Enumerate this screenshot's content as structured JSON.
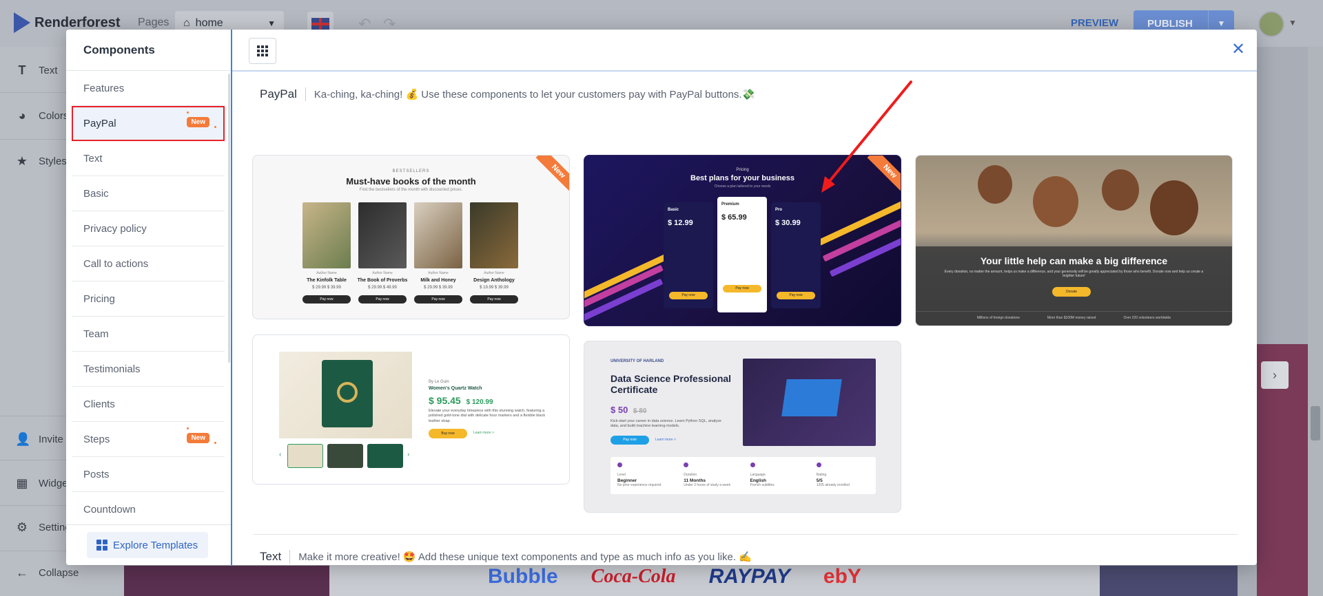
{
  "app": {
    "brand": "Renderforest",
    "pages_label": "Pages",
    "current_page": "home",
    "preview_label": "PREVIEW",
    "publish_label": "PUBLISH"
  },
  "sidebar": {
    "items": [
      {
        "label": "Text",
        "icon": "text-icon"
      },
      {
        "label": "Colors",
        "icon": "palette-icon"
      },
      {
        "label": "Styles",
        "icon": "star-icon"
      },
      {
        "label": "Invite",
        "icon": "add-user-icon"
      },
      {
        "label": "Widgets",
        "icon": "widgets-icon"
      },
      {
        "label": "Settings",
        "icon": "gear-icon"
      },
      {
        "label": "Collapse",
        "icon": "arrow-left-icon"
      }
    ]
  },
  "canvas": {
    "brands": [
      "Bubble",
      "Coca-Cola",
      "RAYPAY",
      "ebY"
    ]
  },
  "modal": {
    "title": "Components",
    "categories": [
      {
        "label": "Features",
        "badge": ""
      },
      {
        "label": "PayPal",
        "badge": "New"
      },
      {
        "label": "Text",
        "badge": ""
      },
      {
        "label": "Basic",
        "badge": ""
      },
      {
        "label": "Privacy policy",
        "badge": ""
      },
      {
        "label": "Call to actions",
        "badge": ""
      },
      {
        "label": "Pricing",
        "badge": ""
      },
      {
        "label": "Team",
        "badge": ""
      },
      {
        "label": "Testimonials",
        "badge": ""
      },
      {
        "label": "Clients",
        "badge": ""
      },
      {
        "label": "Steps",
        "badge": "New"
      },
      {
        "label": "Posts",
        "badge": ""
      },
      {
        "label": "Countdown",
        "badge": ""
      }
    ],
    "explore_label": "Explore Templates",
    "sections": [
      {
        "name": "PayPal",
        "description": "Ka-ching, ka-ching! 💰 Use these components to let your customers pay with PayPal buttons.💸"
      },
      {
        "name": "Text",
        "description": "Make it more creative! 🤩 Add these unique text components and type as much info as you like. ✍️"
      }
    ],
    "ribbon_label": "New",
    "cards": {
      "books": {
        "pre": "BESTSELLERS",
        "title": "Must-have books of the month",
        "subtitle": "Find the bestsellers of the month with discounted prices.",
        "items": [
          {
            "meta": "Author Name",
            "title": "The Kinfolk Table",
            "price": "$ 29.99  $ 39.99",
            "btn": "Pay now"
          },
          {
            "meta": "Author Name",
            "title": "The Book of Proverbs",
            "price": "$ 29.99  $ 49.99",
            "btn": "Pay now"
          },
          {
            "meta": "Author Name",
            "title": "Milk and Honey",
            "price": "$ 29.99  $ 39.99",
            "btn": "Pay now"
          },
          {
            "meta": "Author Name",
            "title": "Design Anthology",
            "price": "$ 19.99  $ 39.99",
            "btn": "Pay now"
          }
        ]
      },
      "pricing": {
        "pre": "Pricing",
        "title": "Best plans for your business",
        "subtitle": "Choose a plan tailored to your needs",
        "plans": [
          {
            "name": "Basic",
            "price": "$ 12.99",
            "btn": "Pay now"
          },
          {
            "name": "Premium",
            "price": "$ 65.99",
            "btn": "Pay now"
          },
          {
            "name": "Pro",
            "price": "$ 30.99",
            "btn": "Pay now"
          }
        ]
      },
      "donation": {
        "title": "Your little help can make a big difference",
        "subtitle": "Every donation, no matter the amount, helps us make a difference, and your generosity will be greatly appreciated by those who benefit. Donate now and help us create a brighter future!",
        "btn": "Donate",
        "stats": [
          "Millions of foreign donations",
          "More than $100M money raised",
          "Over 220 volunteers worldwide"
        ]
      },
      "watch": {
        "meta": "By Le Guin",
        "title": "Women's Quartz Watch",
        "price": "$ 95.45",
        "old_price": "$ 120.99",
        "description": "Elevate your everyday timepiece with this stunning watch, featuring a polished gold-tone dial with delicate hour markers and a flexible black leather strap.",
        "btn": "Buy now",
        "learn": "Learn more >"
      },
      "certificate": {
        "university": "UNIVERSITY OF HARLAND",
        "title": "Data Science Professional Certificate",
        "price": "$ 50",
        "old_price": "$ 80",
        "description": "Kick-start your career in data science. Learn Python SQL, analyze data, and build machine learning models.",
        "btn": "Pay now",
        "learn": "Learn more >",
        "info": [
          {
            "label": "Level",
            "value": "Beginner",
            "note": "No prior experience required"
          },
          {
            "label": "Duration",
            "value": "11 Months",
            "note": "Under 2 hours of study a week"
          },
          {
            "label": "Language",
            "value": "English",
            "note": "French subtitles"
          },
          {
            "label": "Rating",
            "value": "5/5",
            "note": "1205 already enrolled"
          }
        ]
      }
    }
  },
  "colors": {
    "accent": "#3e7fe0",
    "badge": "#f47b3a",
    "highlight": "#e8202a"
  }
}
